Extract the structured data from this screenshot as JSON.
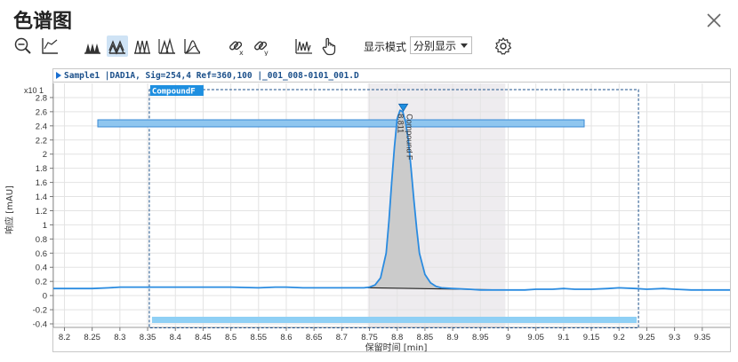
{
  "window": {
    "title": "色谱图"
  },
  "toolbar": {
    "buttons": [
      {
        "name": "zoom-out-icon"
      },
      {
        "name": "baseline-icon"
      },
      {
        "name": "overlay-peaks-icon"
      },
      {
        "name": "stack-peaks-icon",
        "active": true
      },
      {
        "name": "separate-peaks-icon"
      },
      {
        "name": "shade-peaks-icon"
      },
      {
        "name": "area-peaks-icon"
      },
      {
        "name": "unlink-x-icon"
      },
      {
        "name": "unlink-y-icon"
      },
      {
        "name": "integration-icon"
      },
      {
        "name": "hand-pointer-icon"
      }
    ],
    "display_mode_label": "显示模式",
    "display_mode_value": "分别显示",
    "settings": "gear-icon"
  },
  "chart_data": {
    "type": "line",
    "header": "Sample1 |DAD1A, Sig=254,4 Ref=360,100 |_001_008-0101_001.D",
    "compound_label": "CompoundF",
    "ylabel": "响应 [mAU]",
    "xlabel": "保留时间 [min]",
    "y_multiplier": "x10 1",
    "xlim": [
      8.18,
      9.4
    ],
    "ylim": [
      -0.45,
      3.0
    ],
    "x_ticks": [
      "8.2",
      "8.25",
      "8.3",
      "8.35",
      "8.4",
      "8.45",
      "8.5",
      "8.55",
      "8.6",
      "8.65",
      "8.7",
      "8.75",
      "8.8",
      "8.85",
      "8.9",
      "8.95",
      "9",
      "9.05",
      "9.1",
      "9.15",
      "9.2",
      "9.25",
      "9.3",
      "9.35"
    ],
    "y_ticks": [
      "-0.4",
      "-0.2",
      "0",
      "0.2",
      "0.4",
      "0.6",
      "0.8",
      "1",
      "1.2",
      "1.4",
      "1.6",
      "1.8",
      "2",
      "2.2",
      "2.4",
      "2.6",
      "2.8"
    ],
    "series": [
      {
        "name": "",
        "x": [
          8.18,
          8.2,
          8.25,
          8.28,
          8.3,
          8.33,
          8.35,
          8.4,
          8.45,
          8.5,
          8.55,
          8.58,
          8.6,
          8.63,
          8.65,
          8.7,
          8.74,
          8.75,
          8.76,
          8.77,
          8.78,
          8.785,
          8.79,
          8.795,
          8.8,
          8.805,
          8.81,
          8.815,
          8.82,
          8.825,
          8.83,
          8.835,
          8.84,
          8.85,
          8.86,
          8.87,
          8.88,
          8.9,
          8.93,
          8.95,
          8.97,
          9.0,
          9.03,
          9.05,
          9.08,
          9.1,
          9.12,
          9.15,
          9.18,
          9.2,
          9.23,
          9.25,
          9.28,
          9.3,
          9.33,
          9.35,
          9.4
        ],
        "y": [
          0.1,
          0.1,
          0.1,
          0.11,
          0.12,
          0.12,
          0.12,
          0.12,
          0.12,
          0.12,
          0.11,
          0.12,
          0.12,
          0.11,
          0.11,
          0.11,
          0.11,
          0.12,
          0.15,
          0.25,
          0.6,
          1.05,
          1.6,
          2.1,
          2.5,
          2.62,
          2.6,
          2.45,
          2.2,
          1.8,
          1.35,
          0.95,
          0.6,
          0.3,
          0.18,
          0.13,
          0.11,
          0.1,
          0.09,
          0.08,
          0.08,
          0.08,
          0.08,
          0.09,
          0.09,
          0.1,
          0.09,
          0.09,
          0.1,
          0.11,
          0.1,
          0.09,
          0.1,
          0.09,
          0.08,
          0.08,
          0.08
        ]
      }
    ],
    "peak": {
      "rt": "8.811",
      "name": "Compound F",
      "x": 8.811,
      "y": 2.62
    },
    "integration_region": [
      8.747,
      8.995
    ],
    "compound_window": [
      8.353,
      9.235
    ],
    "grid": true
  }
}
